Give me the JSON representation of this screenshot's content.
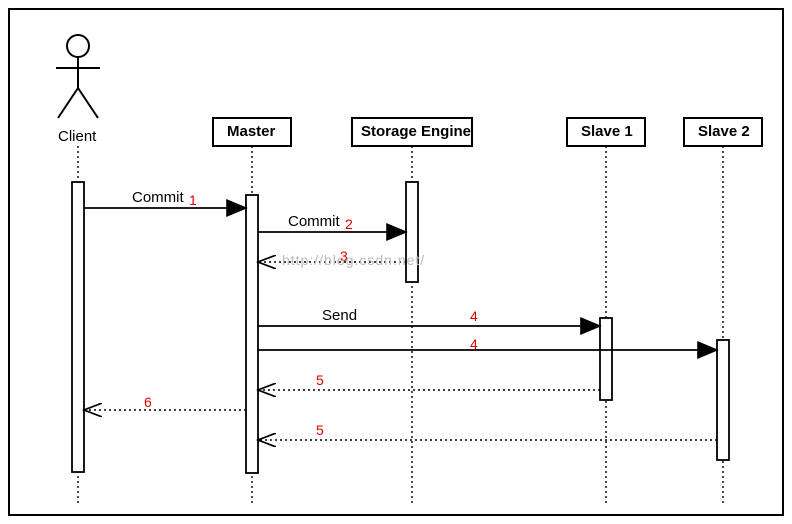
{
  "participants": {
    "client": "Client",
    "master": "Master",
    "storage": "Storage Engine",
    "slave1": "Slave 1",
    "slave2": "Slave 2"
  },
  "messages": {
    "commit1": "Commit",
    "commit2": "Commit",
    "send": "Send"
  },
  "nums": {
    "n1": "1",
    "n2": "2",
    "n3": "3",
    "n4a": "4",
    "n4b": "4",
    "n5a": "5",
    "n5b": "5",
    "n6": "6"
  },
  "watermark": "http://blog.csdn.net/"
}
